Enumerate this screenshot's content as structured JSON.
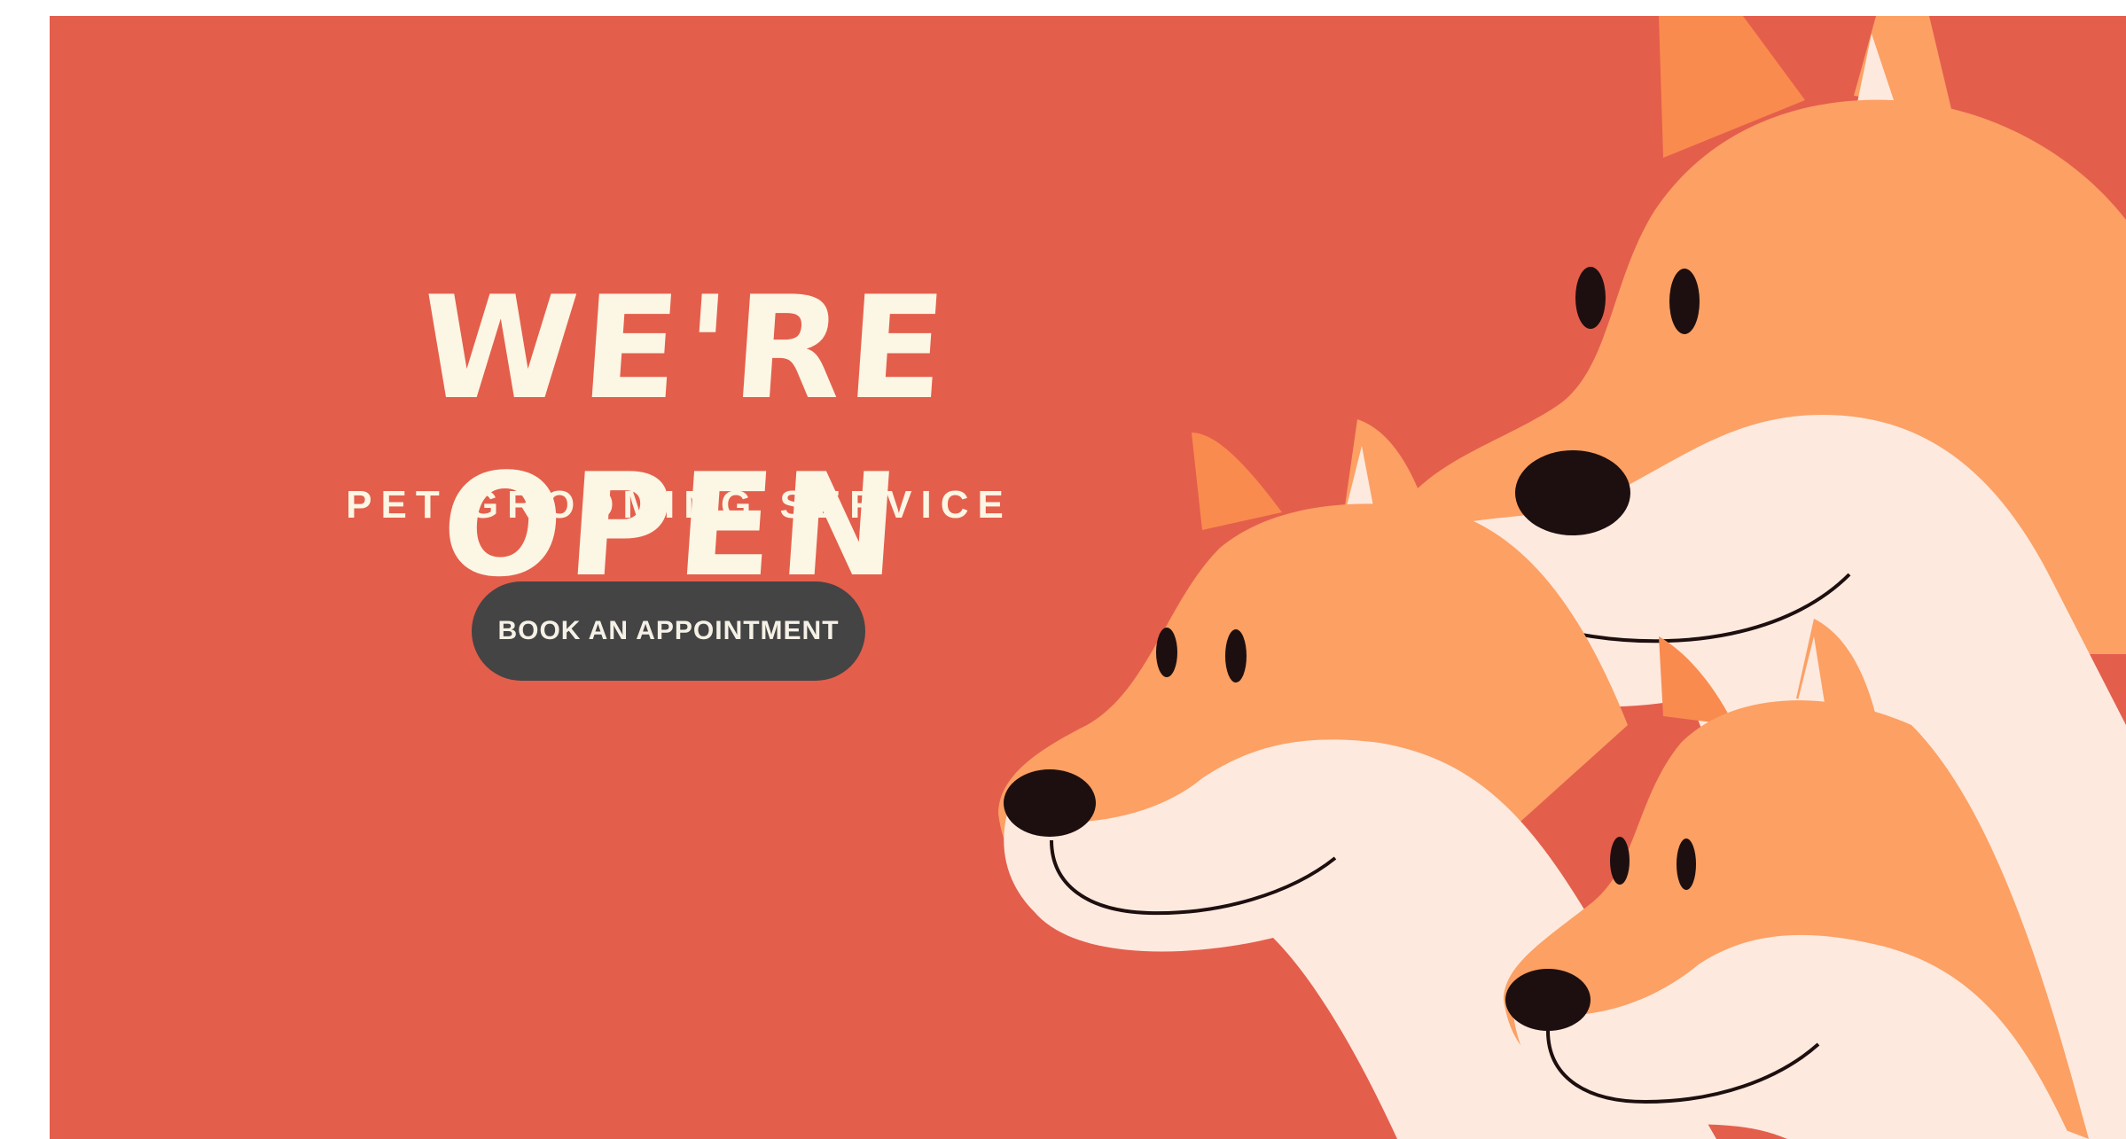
{
  "hero": {
    "headline": "WE'RE OPEN",
    "subtitle": "PET GROOMING SERVICE",
    "cta_label": "BOOK AN APPOINTMENT"
  },
  "colors": {
    "background": "#e45e4c",
    "headline": "#fcf6e4",
    "button": "#444444",
    "dog_fur": "#fca064",
    "dog_fur_dark": "#f98b4e",
    "dog_muzzle": "#fde9de",
    "dog_nose": "#1d0f0f"
  },
  "illustration": {
    "subject": "three-cartoon-dogs",
    "count": 3
  }
}
